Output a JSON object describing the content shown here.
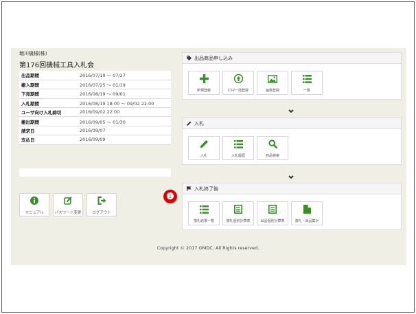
{
  "company": "堀川機械(株)",
  "auction_title": "第176回機械工具入札会",
  "schedule": [
    {
      "label": "出品期間",
      "value": "2016/07/19 〜 07/27"
    },
    {
      "label": "搬入期間",
      "value": "2016/07/25 〜 01/19"
    },
    {
      "label": "下見期間",
      "value": "2016/08/19 〜 09/01"
    },
    {
      "label": "入札期間",
      "value": "2016/08/19 18:00 〜 09/02 22:00"
    },
    {
      "label": "ユーザ向け入札締切",
      "value": "2016/09/02 22:00"
    },
    {
      "label": "搬出期間",
      "value": "2016/09/05 〜 01/30"
    },
    {
      "label": "請求日",
      "value": "2016/09/07"
    },
    {
      "label": "支払日",
      "value": "2016/09/09"
    }
  ],
  "left_buttons": [
    {
      "label": "マニュアル",
      "icon": "info-icon"
    },
    {
      "label": "パスワード変更",
      "icon": "edit-icon"
    },
    {
      "label": "ログアウト",
      "icon": "logout-icon"
    }
  ],
  "panels": {
    "listing": {
      "title": "出品商品申し込み",
      "header_icon": "tag-icon",
      "buttons": [
        {
          "label": "新規登録",
          "icon": "plus-icon"
        },
        {
          "label": "CSV一括登録",
          "icon": "upload-icon"
        },
        {
          "label": "画像登録",
          "icon": "image-icon"
        },
        {
          "label": "一覧",
          "icon": "list-icon"
        }
      ]
    },
    "bidding": {
      "title": "入札",
      "header_icon": "pencil-icon",
      "buttons": [
        {
          "label": "入札",
          "icon": "pencil-icon"
        },
        {
          "label": "入札履歴",
          "icon": "list-icon"
        },
        {
          "label": "商品検索",
          "icon": "search-icon"
        }
      ]
    },
    "after": {
      "title": "入札終了後",
      "header_icon": "flag-icon",
      "buttons": [
        {
          "label": "落札結果一覧",
          "icon": "list-icon"
        },
        {
          "label": "落札個別計算表",
          "icon": "sheet-icon"
        },
        {
          "label": "出品個別計算表",
          "icon": "sheet-icon"
        },
        {
          "label": "落札・出品集計",
          "icon": "file-icon"
        }
      ]
    }
  },
  "callout": "❶",
  "colors": {
    "accent": "#3b8c2a",
    "background": "#efefe6",
    "callout": "#dd0000"
  },
  "copyright": "Copyright © 2017 OMDC. All Rights reserved."
}
